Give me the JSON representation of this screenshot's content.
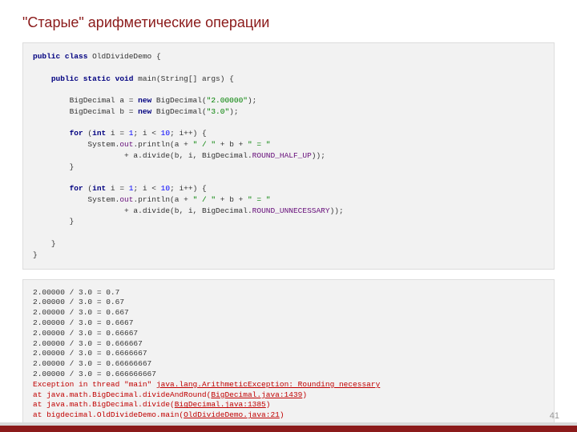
{
  "title": "\"Старые\" арифметические операции",
  "pageNumber": "41",
  "code": {
    "classDecl": {
      "kw1": "public class",
      "name": "OldDivideDemo {"
    },
    "mainDecl": {
      "kw1": "public static void",
      "name": "main(String[] args) {"
    },
    "varA": {
      "pre": "BigDecimal a = ",
      "kwNew": "new",
      "post": " BigDecimal(",
      "str": "\"2.00000\"",
      "end": ");"
    },
    "varB": {
      "pre": "BigDecimal b = ",
      "kwNew": "new",
      "post": " BigDecimal(",
      "str": "\"3.0\"",
      "end": ");"
    },
    "for1": {
      "kwFor": "for",
      "open": " (",
      "kwInt": "int",
      "init": " i = ",
      "one": "1",
      "cond": "; i < ",
      "ten": "10",
      "rest": "; i++) {"
    },
    "print1a": {
      "pre": "System.",
      "out": "out",
      "mid": ".println(a + ",
      "s1": "\" / \"",
      "mid2": " + b + ",
      "s2": "\" = \""
    },
    "print1b": {
      "pre": "+ a.divide(b, i, BigDecimal.",
      "mode": "ROUND_HALF_UP",
      "end": "));"
    },
    "close1": "}",
    "for2": {
      "kwFor": "for",
      "open": " (",
      "kwInt": "int",
      "init": " i = ",
      "one": "1",
      "cond": "; i < ",
      "ten": "10",
      "rest": "; i++) {"
    },
    "print2a": {
      "pre": "System.",
      "out": "out",
      "mid": ".println(a + ",
      "s1": "\" / \"",
      "mid2": " + b + ",
      "s2": "\" = \""
    },
    "print2b": {
      "pre": "+ a.divide(b, i, BigDecimal.",
      "mode": "ROUND_UNNECESSARY",
      "end": "));"
    },
    "close2": "}",
    "closeMain": "}",
    "closeClass": "}"
  },
  "output": {
    "lines": [
      "2.00000 / 3.0 = 0.7",
      "2.00000 / 3.0 = 0.67",
      "2.00000 / 3.0 = 0.667",
      "2.00000 / 3.0 = 0.6667",
      "2.00000 / 3.0 = 0.66667",
      "2.00000 / 3.0 = 0.666667",
      "2.00000 / 3.0 = 0.6666667",
      "2.00000 / 3.0 = 0.66666667",
      "2.00000 / 3.0 = 0.666666667"
    ],
    "exc1a": "Exception in thread \"main\" ",
    "exc1b": "java.lang.ArithmeticException: Rounding necessary",
    "exc2a": "at java.math.BigDecimal.divideAndRound(",
    "exc2b": "BigDecimal.java:1439",
    "exc2c": ")",
    "exc3a": "at java.math.BigDecimal.divide(",
    "exc3b": "BigDecimal.java:1385",
    "exc3c": ")",
    "exc4a": "at bigdecimal.OldDivideDemo.main(",
    "exc4b": "OldDivideDemo.java:21",
    "exc4c": ")"
  }
}
